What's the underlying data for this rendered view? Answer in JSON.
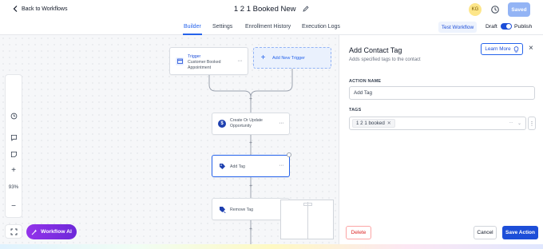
{
  "header": {
    "back_label": "Back to Workflows",
    "workflow_name": "1 2 1 Booked New",
    "avatar_initials": "KG",
    "saved_label": "Saved"
  },
  "tabs": [
    {
      "label": "Builder",
      "active": true
    },
    {
      "label": "Settings",
      "active": false
    },
    {
      "label": "Enrollment History",
      "active": false
    },
    {
      "label": "Execution Logs",
      "active": false
    }
  ],
  "actions": {
    "test_workflow": "Test Workflow",
    "draft": "Draft",
    "publish": "Publish",
    "publish_on": true
  },
  "canvas": {
    "trigger": {
      "title": "Trigger",
      "subtitle": "Customer Booked Appointment",
      "icon": "calendar-icon"
    },
    "add_trigger": "Add New Trigger",
    "nodes": [
      {
        "label": "Create Or Update Opportunity",
        "icon": "dollar-icon"
      },
      {
        "label": "Add Tag",
        "icon": "tag-icon"
      },
      {
        "label": "Remove Tag",
        "icon": "tag-remove-icon"
      }
    ],
    "zoom": "93%",
    "workflow_ai": "Workflow AI"
  },
  "panel": {
    "title": "Add Contact Tag",
    "subtitle": "Adds specified tags to the contact",
    "learn_more": "Learn More",
    "action_name_label": "ACTION NAME",
    "action_name_value": "Add Tag",
    "tags_label": "TAGS",
    "tags": [
      "1 2 1 booked"
    ],
    "delete": "Delete",
    "cancel": "Cancel",
    "save": "Save Action"
  },
  "colors": {
    "accent": "#2563eb",
    "saved_button": "#93b4f5",
    "ai_button": "#7e22ce",
    "delete": "#dc2626",
    "avatar_bg": "#fde68a"
  }
}
